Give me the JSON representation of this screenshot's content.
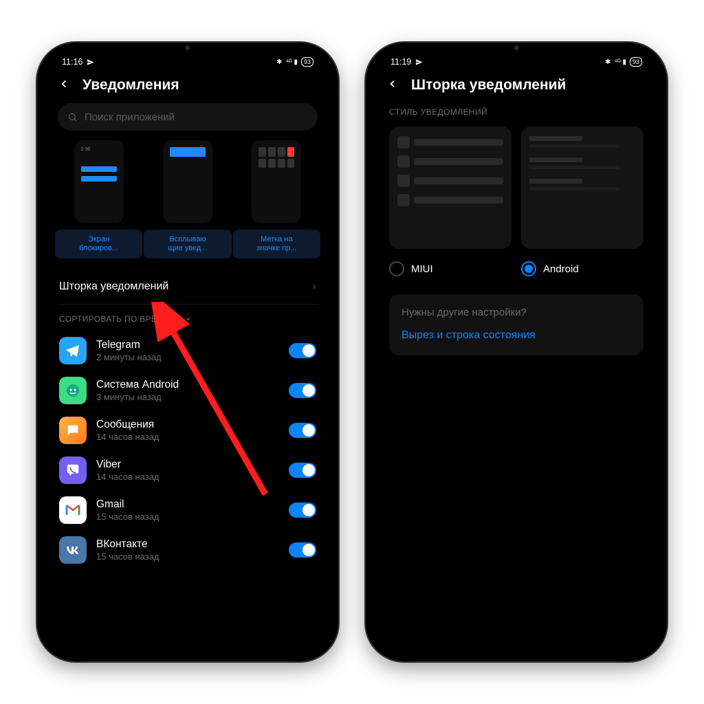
{
  "phone1": {
    "status": {
      "time": "11:16",
      "battery": "93"
    },
    "title": "Уведомления",
    "searchPlaceholder": "Поиск приложений",
    "cards": [
      {
        "line1": "Экран",
        "line2": "блокиров..."
      },
      {
        "line1": "Всплываю",
        "line2": "щие увед..."
      },
      {
        "line1": "Метка на",
        "line2": "значке пр..."
      }
    ],
    "rowLabel": "Шторка уведомлений",
    "sortLabel": "СОРТИРОВАТЬ ПО ВРЕМЕНИ",
    "apps": [
      {
        "name": "Telegram",
        "sub": "2 минуты назад",
        "bg": "#2aa4f4"
      },
      {
        "name": "Система Android",
        "sub": "3 минуты назад",
        "bg": "#3ddc84"
      },
      {
        "name": "Сообщения",
        "sub": "14 часов назад",
        "bg": "linear-gradient(135deg,#ffb347,#ff7a18)"
      },
      {
        "name": "Viber",
        "sub": "14 часов назад",
        "bg": "#7360f2"
      },
      {
        "name": "Gmail",
        "sub": "15 часов назад",
        "bg": "#fff"
      },
      {
        "name": "ВКонтакте",
        "sub": "15 часов назад",
        "bg": "#4a76a8"
      }
    ]
  },
  "phone2": {
    "status": {
      "time": "11:19",
      "battery": "93"
    },
    "title": "Шторка уведомлений",
    "sectionLabel": "СТИЛЬ УВЕДОМЛЕНИЙ",
    "radios": {
      "miui": "MIUI",
      "android": "Android",
      "selected": "android"
    },
    "card": {
      "q": "Нужны другие настройки?",
      "link": "Вырез и строка состояния"
    }
  }
}
